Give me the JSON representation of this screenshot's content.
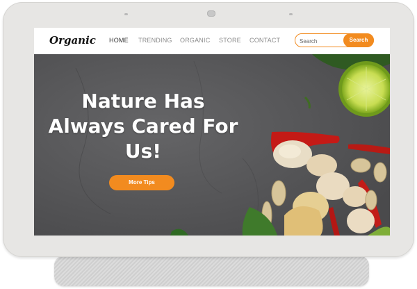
{
  "brand": {
    "logo": "Organic"
  },
  "nav": {
    "items": [
      {
        "label": "HOME",
        "active": true
      },
      {
        "label": "TRENDING",
        "active": false
      },
      {
        "label": "ORGANIC",
        "active": false
      },
      {
        "label": "STORE",
        "active": false
      },
      {
        "label": "CONTACT",
        "active": false
      }
    ]
  },
  "search": {
    "placeholder": "Search",
    "value": "",
    "button_label": "Search"
  },
  "hero": {
    "title_line1": "Nature Has",
    "title_line2": "Always Cared For",
    "title_line3": "Us!",
    "cta_label": "More Tips"
  },
  "colors": {
    "accent": "#f28b1f",
    "hero_background": "#58585a",
    "device_frame": "#e7e6e4"
  }
}
